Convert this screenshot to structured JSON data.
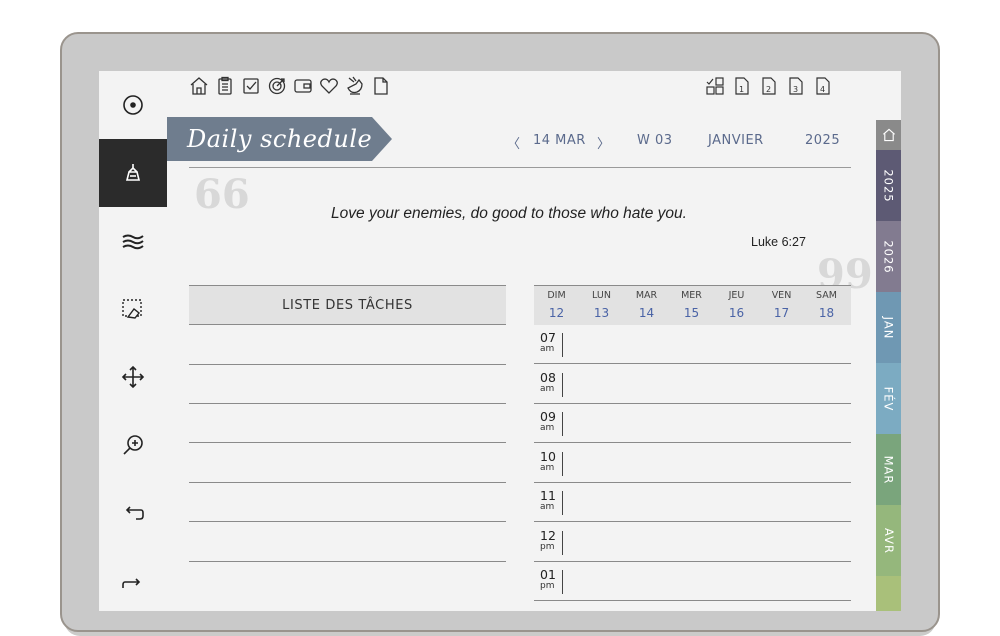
{
  "top_icons": [
    "home-icon",
    "clipboard-icon",
    "checkbox-icon",
    "target-icon",
    "wallet-icon",
    "heart-icon",
    "bird-icon",
    "page-icon"
  ],
  "page_icons": [
    "layout-grid-icon",
    "page-1-icon",
    "page-2-icon",
    "page-3-icon",
    "page-4-icon"
  ],
  "tools": [
    "pen-circle-icon",
    "marker-icon",
    "lines-icon",
    "eraser-select-icon",
    "move-icon",
    "zoom-icon",
    "undo-icon",
    "redo-icon"
  ],
  "header": {
    "title": "Daily schedule"
  },
  "nav": {
    "prev": "〈",
    "date": "14 MAR",
    "next": "〉",
    "week": "W 03",
    "month": "JANVIER",
    "year": "2025"
  },
  "quote": {
    "text": "Love your enemies, do good to those who hate you.",
    "reference": "Luke 6:27",
    "open_mark": "66",
    "close_mark": "99"
  },
  "tasks": {
    "title": "LISTE DES TÂCHES"
  },
  "calendar": {
    "days": [
      {
        "name": "DIM",
        "num": "12"
      },
      {
        "name": "LUN",
        "num": "13"
      },
      {
        "name": "MAR",
        "num": "14"
      },
      {
        "name": "MER",
        "num": "15"
      },
      {
        "name": "JEU",
        "num": "16"
      },
      {
        "name": "VEN",
        "num": "17"
      },
      {
        "name": "SAM",
        "num": "18"
      }
    ],
    "hours": [
      {
        "h": "07",
        "ap": "am"
      },
      {
        "h": "08",
        "ap": "am"
      },
      {
        "h": "09",
        "ap": "am"
      },
      {
        "h": "10",
        "ap": "am"
      },
      {
        "h": "11",
        "ap": "am"
      },
      {
        "h": "12",
        "ap": "pm"
      },
      {
        "h": "01",
        "ap": "pm"
      }
    ]
  },
  "side_tabs": [
    {
      "label": "",
      "icon": "home-icon",
      "color": "#8a8a8a"
    },
    {
      "label": "2025",
      "color": "#5d5a74"
    },
    {
      "label": "2026",
      "color": "#827b90"
    },
    {
      "label": "JAN",
      "color": "#6f98b3"
    },
    {
      "label": "FÉV",
      "color": "#7cabc2"
    },
    {
      "label": "MAR",
      "color": "#7aa57c"
    },
    {
      "label": "AVR",
      "color": "#95b77c"
    }
  ]
}
